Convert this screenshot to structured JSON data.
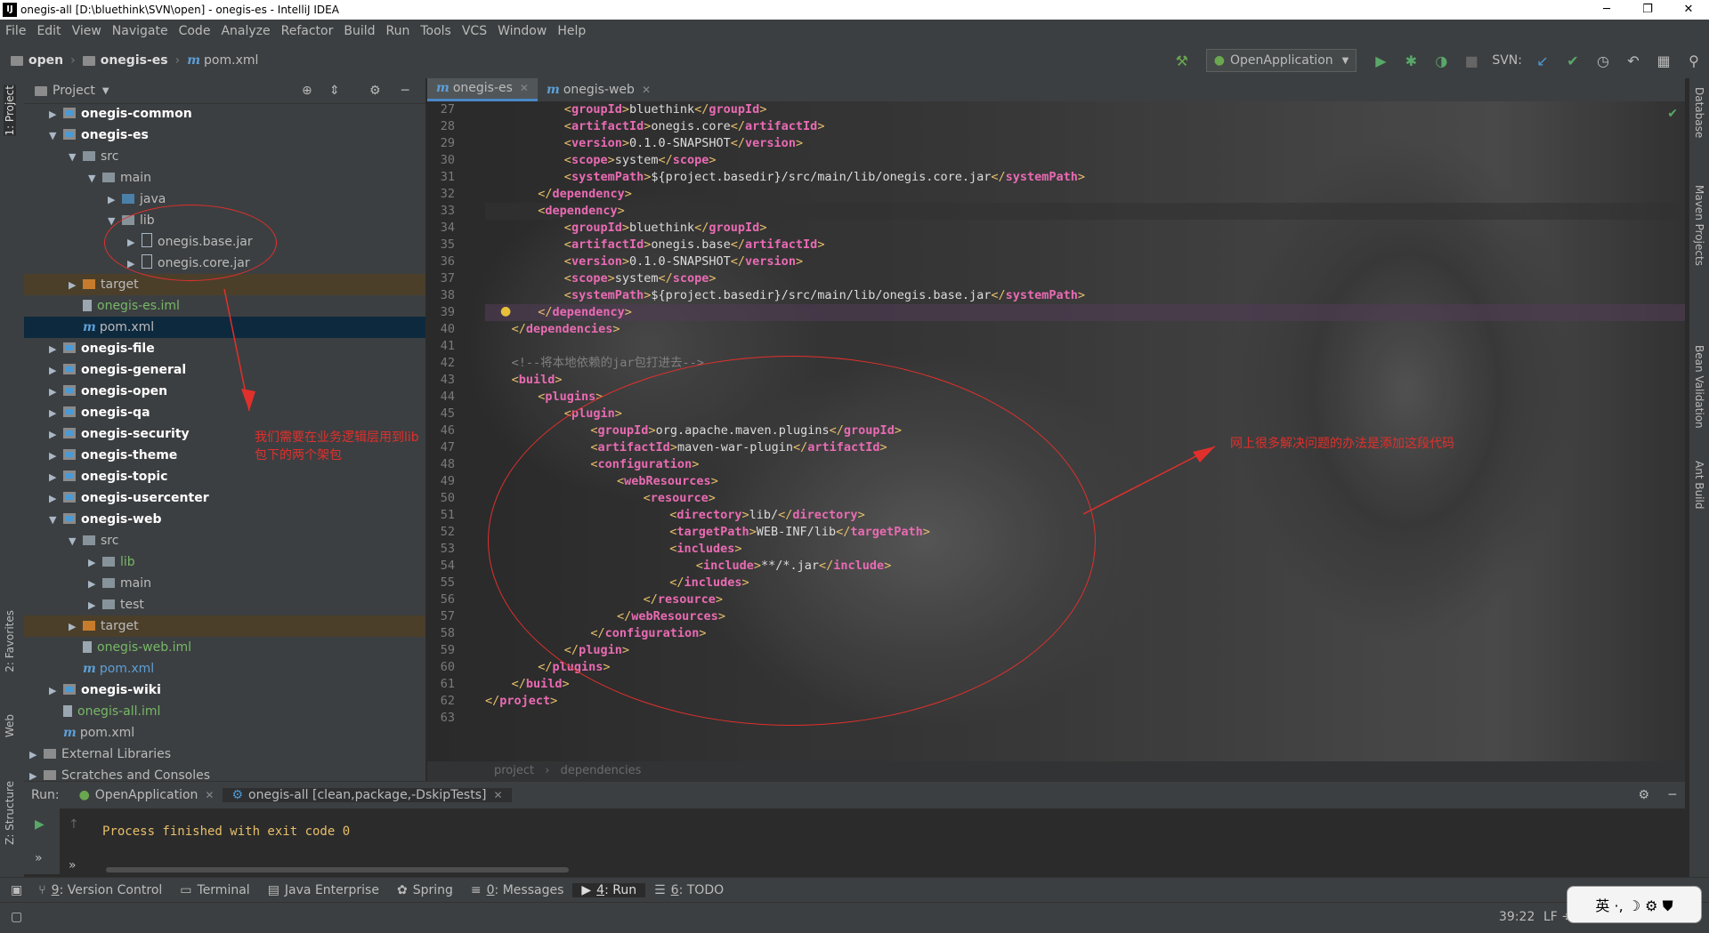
{
  "window": {
    "title": "onegis-all [D:\\bluethink\\SVN\\open] - onegis-es - IntelliJ IDEA",
    "app_icon": "IJ"
  },
  "menu": [
    "File",
    "Edit",
    "View",
    "Navigate",
    "Code",
    "Analyze",
    "Refactor",
    "Build",
    "Run",
    "Tools",
    "VCS",
    "Window",
    "Help"
  ],
  "breadcrumb": {
    "root": "open",
    "module": "onegis-es",
    "file": "pom.xml"
  },
  "toolbar": {
    "run_config": "OpenApplication",
    "svn_label": "SVN:"
  },
  "left_tabs": {
    "project": "1: Project",
    "favorites": "2: Favorites",
    "web": "Web",
    "structure": "Z: Structure"
  },
  "right_tabs": {
    "database": "Database",
    "maven": "Maven Projects",
    "bean": "Bean Validation",
    "ant": "Ant Build"
  },
  "project_panel": {
    "title": "Project"
  },
  "tree": [
    {
      "label": "onegis-common",
      "type": "module",
      "depth": 1,
      "arrow": "▶",
      "bold": true
    },
    {
      "label": "onegis-es",
      "type": "module",
      "depth": 1,
      "arrow": "▼",
      "bold": true
    },
    {
      "label": "src",
      "type": "folder",
      "depth": 2,
      "arrow": "▼"
    },
    {
      "label": "main",
      "type": "folder",
      "depth": 3,
      "arrow": "▼"
    },
    {
      "label": "java",
      "type": "src",
      "depth": 4,
      "arrow": "▶"
    },
    {
      "label": "lib",
      "type": "folder",
      "depth": 4,
      "arrow": "▼"
    },
    {
      "label": "onegis.base.jar",
      "type": "jar",
      "depth": 5,
      "arrow": "▶"
    },
    {
      "label": "onegis.core.jar",
      "type": "jar",
      "depth": 5,
      "arrow": "▶"
    },
    {
      "label": "target",
      "type": "orange",
      "depth": 2,
      "arrow": "▶",
      "hl": true
    },
    {
      "label": "onegis-es.iml",
      "type": "iml",
      "depth": 2,
      "arrow": "",
      "green": true
    },
    {
      "label": "pom.xml",
      "type": "pom",
      "depth": 2,
      "arrow": "",
      "selected": true
    },
    {
      "label": "onegis-file",
      "type": "module",
      "depth": 1,
      "arrow": "▶",
      "bold": true
    },
    {
      "label": "onegis-general",
      "type": "module",
      "depth": 1,
      "arrow": "▶",
      "bold": true
    },
    {
      "label": "onegis-open",
      "type": "module",
      "depth": 1,
      "arrow": "▶",
      "bold": true
    },
    {
      "label": "onegis-qa",
      "type": "module",
      "depth": 1,
      "arrow": "▶",
      "bold": true
    },
    {
      "label": "onegis-security",
      "type": "module",
      "depth": 1,
      "arrow": "▶",
      "bold": true
    },
    {
      "label": "onegis-theme",
      "type": "module",
      "depth": 1,
      "arrow": "▶",
      "bold": true
    },
    {
      "label": "onegis-topic",
      "type": "module",
      "depth": 1,
      "arrow": "▶",
      "bold": true
    },
    {
      "label": "onegis-usercenter",
      "type": "module",
      "depth": 1,
      "arrow": "▶",
      "bold": true
    },
    {
      "label": "onegis-web",
      "type": "module",
      "depth": 1,
      "arrow": "▼",
      "bold": true
    },
    {
      "label": "src",
      "type": "folder",
      "depth": 2,
      "arrow": "▼"
    },
    {
      "label": "lib",
      "type": "folder",
      "depth": 3,
      "arrow": "▶",
      "green": true
    },
    {
      "label": "main",
      "type": "folder",
      "depth": 3,
      "arrow": "▶"
    },
    {
      "label": "test",
      "type": "folder",
      "depth": 3,
      "arrow": "▶"
    },
    {
      "label": "target",
      "type": "orange",
      "depth": 2,
      "arrow": "▶",
      "hl": true
    },
    {
      "label": "onegis-web.iml",
      "type": "iml",
      "depth": 2,
      "arrow": "",
      "green": true
    },
    {
      "label": "pom.xml",
      "type": "pom",
      "depth": 2,
      "arrow": "",
      "blue": true
    },
    {
      "label": "onegis-wiki",
      "type": "module",
      "depth": 1,
      "arrow": "▶",
      "bold": true
    },
    {
      "label": "onegis-all.iml",
      "type": "iml",
      "depth": 1,
      "arrow": "",
      "green": true
    },
    {
      "label": "pom.xml",
      "type": "pom",
      "depth": 1,
      "arrow": ""
    },
    {
      "label": "External Libraries",
      "type": "lib",
      "depth": 0,
      "arrow": "▶"
    },
    {
      "label": "Scratches and Consoles",
      "type": "scratch",
      "depth": 0,
      "arrow": "▶"
    }
  ],
  "editor_tabs": [
    {
      "label": "onegis-es",
      "active": true
    },
    {
      "label": "onegis-web",
      "active": false
    }
  ],
  "code_lines": [
    {
      "n": "27",
      "indent": 3,
      "tokens": [
        [
          "p",
          "<"
        ],
        [
          "n",
          "groupId"
        ],
        [
          "p",
          ">"
        ],
        [
          "t",
          "bluethink"
        ],
        [
          "p",
          "</"
        ],
        [
          "n",
          "groupId"
        ],
        [
          "p",
          ">"
        ]
      ]
    },
    {
      "n": "28",
      "indent": 3,
      "tokens": [
        [
          "p",
          "<"
        ],
        [
          "n",
          "artifactId"
        ],
        [
          "p",
          ">"
        ],
        [
          "t",
          "onegis.core"
        ],
        [
          "p",
          "</"
        ],
        [
          "n",
          "artifactId"
        ],
        [
          "p",
          ">"
        ]
      ]
    },
    {
      "n": "29",
      "indent": 3,
      "tokens": [
        [
          "p",
          "<"
        ],
        [
          "n",
          "version"
        ],
        [
          "p",
          ">"
        ],
        [
          "t",
          "0.1.0-SNAPSHOT"
        ],
        [
          "p",
          "</"
        ],
        [
          "n",
          "version"
        ],
        [
          "p",
          ">"
        ]
      ]
    },
    {
      "n": "30",
      "indent": 3,
      "tokens": [
        [
          "p",
          "<"
        ],
        [
          "n",
          "scope"
        ],
        [
          "p",
          ">"
        ],
        [
          "t",
          "system"
        ],
        [
          "p",
          "</"
        ],
        [
          "n",
          "scope"
        ],
        [
          "p",
          ">"
        ]
      ]
    },
    {
      "n": "31",
      "indent": 3,
      "tokens": [
        [
          "p",
          "<"
        ],
        [
          "n",
          "systemPath"
        ],
        [
          "p",
          ">"
        ],
        [
          "t",
          "${project.basedir}/src/main/lib/onegis.core.jar"
        ],
        [
          "p",
          "</"
        ],
        [
          "n",
          "systemPath"
        ],
        [
          "p",
          ">"
        ]
      ]
    },
    {
      "n": "32",
      "indent": 2,
      "tokens": [
        [
          "p",
          "</"
        ],
        [
          "n",
          "dependency"
        ],
        [
          "p",
          ">"
        ]
      ]
    },
    {
      "n": "33",
      "indent": 2,
      "cur": true,
      "tokens": [
        [
          "p",
          "<"
        ],
        [
          "n",
          "dependency"
        ],
        [
          "p",
          ">"
        ]
      ]
    },
    {
      "n": "34",
      "indent": 3,
      "tokens": [
        [
          "p",
          "<"
        ],
        [
          "n",
          "groupId"
        ],
        [
          "p",
          ">"
        ],
        [
          "t",
          "bluethink"
        ],
        [
          "p",
          "</"
        ],
        [
          "n",
          "groupId"
        ],
        [
          "p",
          ">"
        ]
      ]
    },
    {
      "n": "35",
      "indent": 3,
      "tokens": [
        [
          "p",
          "<"
        ],
        [
          "n",
          "artifactId"
        ],
        [
          "p",
          ">"
        ],
        [
          "t",
          "onegis.base"
        ],
        [
          "p",
          "</"
        ],
        [
          "n",
          "artifactId"
        ],
        [
          "p",
          ">"
        ]
      ]
    },
    {
      "n": "36",
      "indent": 3,
      "tokens": [
        [
          "p",
          "<"
        ],
        [
          "n",
          "version"
        ],
        [
          "p",
          ">"
        ],
        [
          "t",
          "0.1.0-SNAPSHOT"
        ],
        [
          "p",
          "</"
        ],
        [
          "n",
          "version"
        ],
        [
          "p",
          ">"
        ]
      ]
    },
    {
      "n": "37",
      "indent": 3,
      "tokens": [
        [
          "p",
          "<"
        ],
        [
          "n",
          "scope"
        ],
        [
          "p",
          ">"
        ],
        [
          "t",
          "system"
        ],
        [
          "p",
          "</"
        ],
        [
          "n",
          "scope"
        ],
        [
          "p",
          ">"
        ]
      ]
    },
    {
      "n": "38",
      "indent": 3,
      "tokens": [
        [
          "p",
          "<"
        ],
        [
          "n",
          "systemPath"
        ],
        [
          "p",
          ">"
        ],
        [
          "t",
          "${project.basedir}/src/main/lib/onegis.base.jar"
        ],
        [
          "p",
          "</"
        ],
        [
          "n",
          "systemPath"
        ],
        [
          "p",
          ">"
        ]
      ]
    },
    {
      "n": "39",
      "indent": 2,
      "warn": true,
      "tokens": [
        [
          "p",
          "</"
        ],
        [
          "n",
          "dependency"
        ],
        [
          "p",
          ">"
        ]
      ]
    },
    {
      "n": "40",
      "indent": 1,
      "tokens": [
        [
          "p",
          "</"
        ],
        [
          "n",
          "dependencies"
        ],
        [
          "p",
          ">"
        ]
      ]
    },
    {
      "n": "41",
      "indent": 0,
      "tokens": []
    },
    {
      "n": "42",
      "indent": 1,
      "tokens": [
        [
          "c",
          "<!--将本地依赖的jar包打进去-->"
        ]
      ]
    },
    {
      "n": "43",
      "indent": 1,
      "tokens": [
        [
          "p",
          "<"
        ],
        [
          "n",
          "build"
        ],
        [
          "p",
          ">"
        ]
      ]
    },
    {
      "n": "44",
      "indent": 2,
      "tokens": [
        [
          "p",
          "<"
        ],
        [
          "n",
          "plugins"
        ],
        [
          "p",
          ">"
        ]
      ]
    },
    {
      "n": "45",
      "indent": 3,
      "tokens": [
        [
          "p",
          "<"
        ],
        [
          "n",
          "plugin"
        ],
        [
          "p",
          ">"
        ]
      ]
    },
    {
      "n": "46",
      "indent": 4,
      "tokens": [
        [
          "p",
          "<"
        ],
        [
          "n",
          "groupId"
        ],
        [
          "p",
          ">"
        ],
        [
          "t",
          "org.apache.maven.plugins"
        ],
        [
          "p",
          "</"
        ],
        [
          "n",
          "groupId"
        ],
        [
          "p",
          ">"
        ]
      ]
    },
    {
      "n": "47",
      "indent": 4,
      "tokens": [
        [
          "p",
          "<"
        ],
        [
          "n",
          "artifactId"
        ],
        [
          "p",
          ">"
        ],
        [
          "t",
          "maven-war-plugin"
        ],
        [
          "p",
          "</"
        ],
        [
          "n",
          "artifactId"
        ],
        [
          "p",
          ">"
        ]
      ]
    },
    {
      "n": "48",
      "indent": 4,
      "tokens": [
        [
          "p",
          "<"
        ],
        [
          "n",
          "configuration"
        ],
        [
          "p",
          ">"
        ]
      ]
    },
    {
      "n": "49",
      "indent": 5,
      "tokens": [
        [
          "p",
          "<"
        ],
        [
          "n",
          "webResources"
        ],
        [
          "p",
          ">"
        ]
      ]
    },
    {
      "n": "50",
      "indent": 6,
      "tokens": [
        [
          "p",
          "<"
        ],
        [
          "n",
          "resource"
        ],
        [
          "p",
          ">"
        ]
      ]
    },
    {
      "n": "51",
      "indent": 7,
      "tokens": [
        [
          "p",
          "<"
        ],
        [
          "n",
          "directory"
        ],
        [
          "p",
          ">"
        ],
        [
          "t",
          "lib/"
        ],
        [
          "p",
          "</"
        ],
        [
          "n",
          "directory"
        ],
        [
          "p",
          ">"
        ]
      ]
    },
    {
      "n": "52",
      "indent": 7,
      "tokens": [
        [
          "p",
          "<"
        ],
        [
          "n",
          "targetPath"
        ],
        [
          "p",
          ">"
        ],
        [
          "t",
          "WEB-INF/lib"
        ],
        [
          "p",
          "</"
        ],
        [
          "n",
          "targetPath"
        ],
        [
          "p",
          ">"
        ]
      ]
    },
    {
      "n": "53",
      "indent": 7,
      "tokens": [
        [
          "p",
          "<"
        ],
        [
          "n",
          "includes"
        ],
        [
          "p",
          ">"
        ]
      ]
    },
    {
      "n": "54",
      "indent": 8,
      "tokens": [
        [
          "p",
          "<"
        ],
        [
          "n",
          "include"
        ],
        [
          "p",
          ">"
        ],
        [
          "t",
          "**/*.jar"
        ],
        [
          "p",
          "</"
        ],
        [
          "n",
          "include"
        ],
        [
          "p",
          ">"
        ]
      ]
    },
    {
      "n": "55",
      "indent": 7,
      "tokens": [
        [
          "p",
          "</"
        ],
        [
          "n",
          "includes"
        ],
        [
          "p",
          ">"
        ]
      ]
    },
    {
      "n": "56",
      "indent": 6,
      "tokens": [
        [
          "p",
          "</"
        ],
        [
          "n",
          "resource"
        ],
        [
          "p",
          ">"
        ]
      ]
    },
    {
      "n": "57",
      "indent": 5,
      "tokens": [
        [
          "p",
          "</"
        ],
        [
          "n",
          "webResources"
        ],
        [
          "p",
          ">"
        ]
      ]
    },
    {
      "n": "58",
      "indent": 4,
      "tokens": [
        [
          "p",
          "</"
        ],
        [
          "n",
          "configuration"
        ],
        [
          "p",
          ">"
        ]
      ]
    },
    {
      "n": "59",
      "indent": 3,
      "tokens": [
        [
          "p",
          "</"
        ],
        [
          "n",
          "plugin"
        ],
        [
          "p",
          ">"
        ]
      ]
    },
    {
      "n": "60",
      "indent": 2,
      "tokens": [
        [
          "p",
          "</"
        ],
        [
          "n",
          "plugins"
        ],
        [
          "p",
          ">"
        ]
      ]
    },
    {
      "n": "61",
      "indent": 1,
      "tokens": [
        [
          "p",
          "</"
        ],
        [
          "n",
          "build"
        ],
        [
          "p",
          ">"
        ]
      ]
    },
    {
      "n": "62",
      "indent": 0,
      "tokens": [
        [
          "p",
          "</"
        ],
        [
          "n",
          "project"
        ],
        [
          "p",
          ">"
        ]
      ]
    },
    {
      "n": "63",
      "indent": 0,
      "tokens": []
    }
  ],
  "editor_breadcrumb": {
    "a": "project",
    "sep": "›",
    "b": "dependencies"
  },
  "annotations": {
    "left_note": "我们需要在业务逻辑层用到lib包下的两个架包",
    "right_note": "网上很多解决问题的办法是添加这段代码",
    "color": "#e0302c"
  },
  "run": {
    "label": "Run:",
    "tab1": "OpenApplication",
    "tab2": "onegis-all [clean,package,-DskipTests]",
    "output": "Process finished with exit code 0"
  },
  "bottom_tabs": [
    {
      "num": "9",
      "label": ": Version Control"
    },
    {
      "num": "",
      "label": "Terminal"
    },
    {
      "num": "",
      "label": "Java Enterprise"
    },
    {
      "num": "",
      "label": "Spring"
    },
    {
      "num": "0",
      "label": ": Messages"
    },
    {
      "num": "4",
      "label": ": Run",
      "active": true
    },
    {
      "num": "6",
      "label": ": TODO"
    }
  ],
  "status": {
    "position": "39:22",
    "line_sep": "LF ÷"
  },
  "ime": {
    "label": "英 ·, ☽ ⚙ ⛊"
  }
}
